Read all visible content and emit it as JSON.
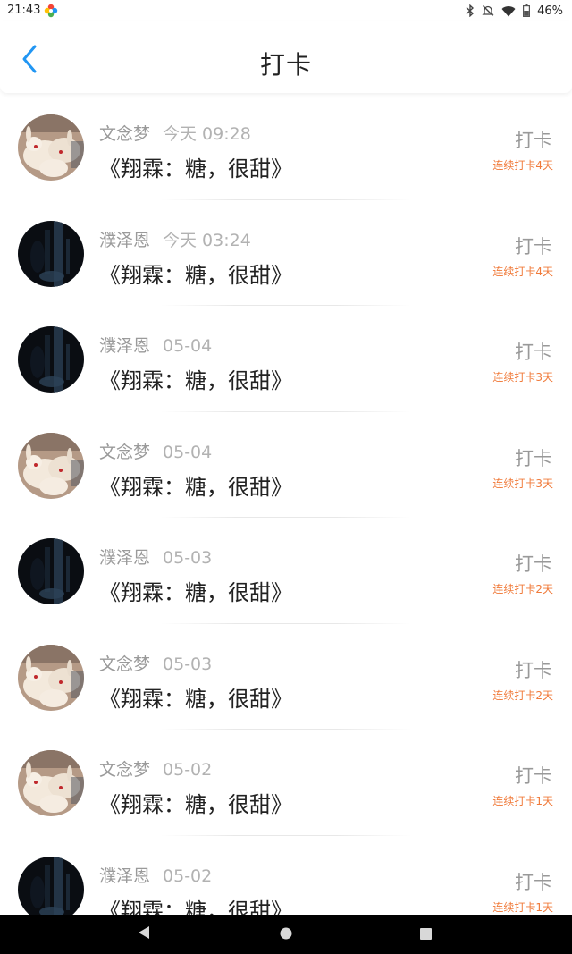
{
  "status_bar": {
    "time": "21:43",
    "battery_percent": "46%",
    "icons": [
      "app-badge-icon",
      "bluetooth-icon",
      "mute-icon",
      "wifi-icon",
      "battery-icon"
    ]
  },
  "header": {
    "title": "打卡",
    "back_icon": "chevron-left-icon",
    "accent_color": "#2196f3"
  },
  "records": [
    {
      "user": "文念梦",
      "time": "今天 09:28",
      "book": "《翔霖：糖，很甜》",
      "action": "打卡",
      "streak": "连续打卡4天",
      "avatar": "rabbits"
    },
    {
      "user": "濮泽恩",
      "time": "今天 03:24",
      "book": "《翔霖：糖，很甜》",
      "action": "打卡",
      "streak": "连续打卡4天",
      "avatar": "dark"
    },
    {
      "user": "濮泽恩",
      "time": "05-04",
      "book": "《翔霖：糖，很甜》",
      "action": "打卡",
      "streak": "连续打卡3天",
      "avatar": "dark"
    },
    {
      "user": "文念梦",
      "time": "05-04",
      "book": "《翔霖：糖，很甜》",
      "action": "打卡",
      "streak": "连续打卡3天",
      "avatar": "rabbits"
    },
    {
      "user": "濮泽恩",
      "time": "05-03",
      "book": "《翔霖：糖，很甜》",
      "action": "打卡",
      "streak": "连续打卡2天",
      "avatar": "dark"
    },
    {
      "user": "文念梦",
      "time": "05-03",
      "book": "《翔霖：糖，很甜》",
      "action": "打卡",
      "streak": "连续打卡2天",
      "avatar": "rabbits"
    },
    {
      "user": "文念梦",
      "time": "05-02",
      "book": "《翔霖：糖，很甜》",
      "action": "打卡",
      "streak": "连续打卡1天",
      "avatar": "rabbits"
    },
    {
      "user": "濮泽恩",
      "time": "05-02",
      "book": "《翔霖：糖，很甜》",
      "action": "打卡",
      "streak": "连续打卡1天",
      "avatar": "dark"
    }
  ],
  "colors": {
    "streak": "#f07a3a",
    "name": "#9a9a9a",
    "title": "#222222"
  },
  "nav_bar": {
    "icons": [
      "back-triangle-icon",
      "home-circle-icon",
      "recents-square-icon"
    ]
  }
}
